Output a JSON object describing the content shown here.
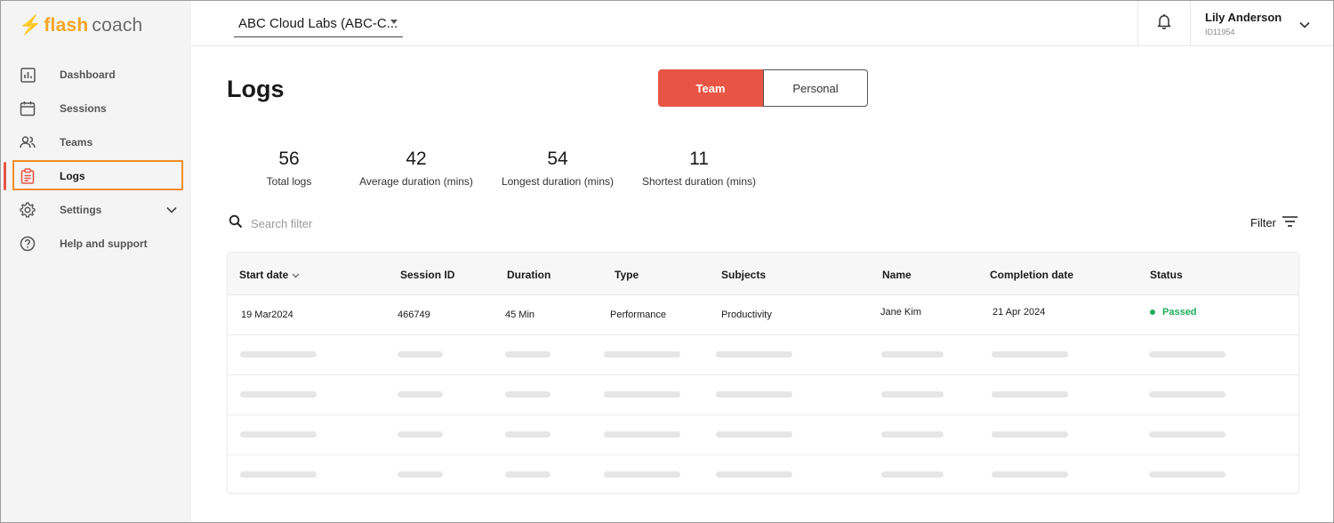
{
  "brand": {
    "bolt": "⚡",
    "flash": "flash",
    "coach": "coach"
  },
  "colors": {
    "accent": "#e85545",
    "brand": "#f5a623",
    "success": "#1fae5b",
    "highlight": "#f28c28"
  },
  "sidebar": {
    "items": [
      {
        "label": "Dashboard",
        "icon": "bar-chart-icon"
      },
      {
        "label": "Sessions",
        "icon": "calendar-icon"
      },
      {
        "label": "Teams",
        "icon": "people-icon"
      },
      {
        "label": "Logs",
        "icon": "clipboard-icon",
        "active": true
      },
      {
        "label": "Settings",
        "icon": "gear-icon",
        "expandable": true
      },
      {
        "label": "Help and support",
        "icon": "help-circle-icon"
      }
    ]
  },
  "header": {
    "org": "ABC Cloud Labs (ABC-C...",
    "user_name": "Lily Anderson",
    "user_id": "ID11954"
  },
  "page": {
    "title": "Logs",
    "toggle": {
      "team": "Team",
      "personal": "Personal",
      "selected": "Team"
    }
  },
  "stats": [
    {
      "value": "56",
      "label": "Total logs"
    },
    {
      "value": "42",
      "label": "Average duration (mins)"
    },
    {
      "value": "54",
      "label": "Longest duration (mins)"
    },
    {
      "value": "11",
      "label": "Shortest duration (mins)"
    }
  ],
  "search": {
    "placeholder": "Search filter"
  },
  "filter": {
    "label": "Filter"
  },
  "table": {
    "columns": [
      "Start date",
      "Session ID",
      "Duration",
      "Type",
      "Subjects",
      "Name",
      "Completion date",
      "Status"
    ],
    "rows": [
      {
        "start_date": "19 Mar2024",
        "session_id": "466749",
        "duration": "45 Min",
        "type": "Performance",
        "subjects": "Productivity",
        "name": "Jane Kim",
        "completion_date": "21 Apr 2024",
        "status": "Passed"
      }
    ]
  }
}
